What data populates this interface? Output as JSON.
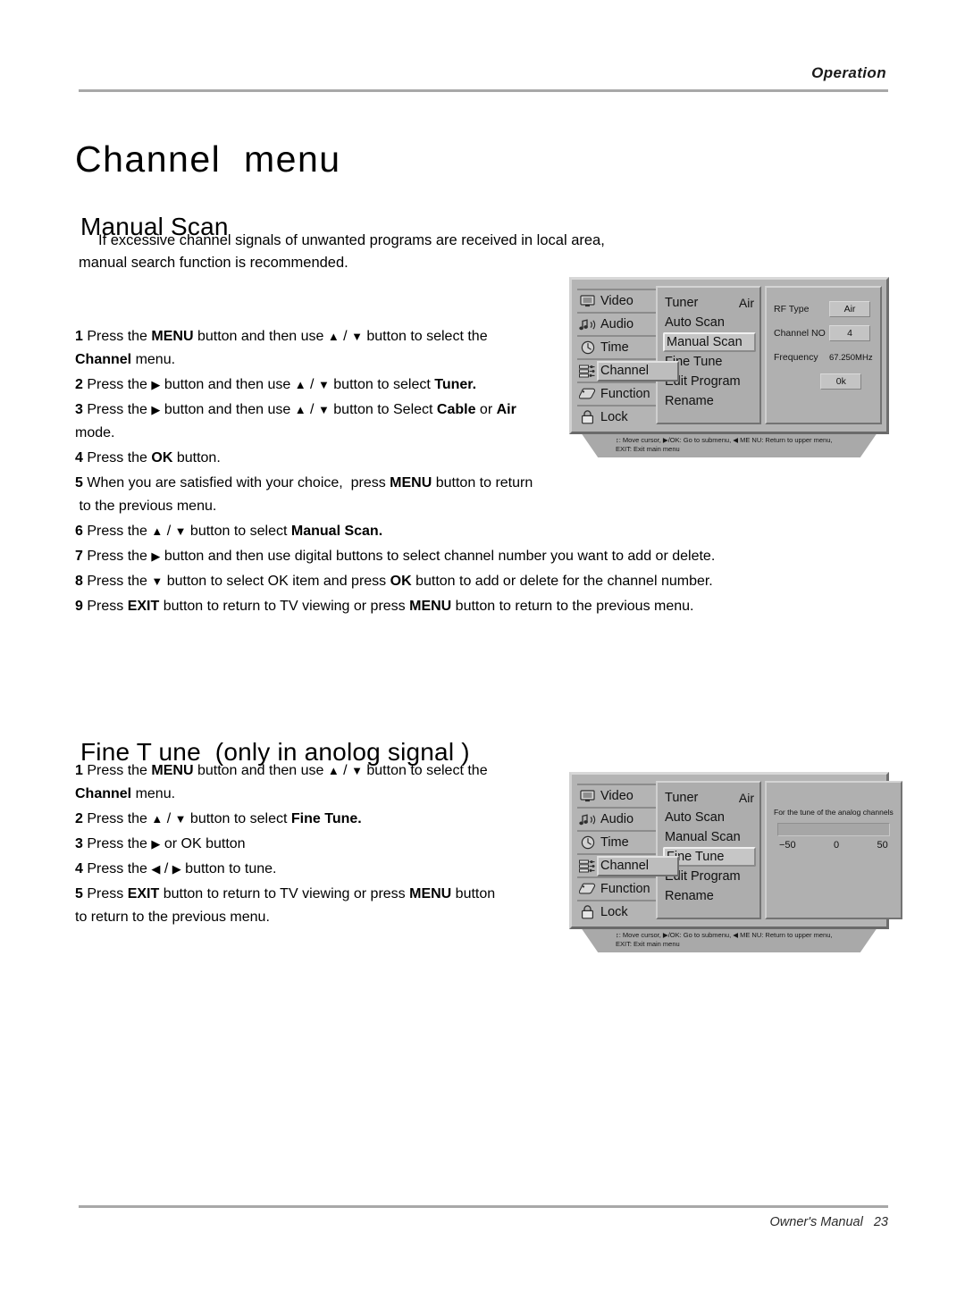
{
  "header": {
    "running_head": "Operation"
  },
  "footer": {
    "manual_label": "Owner's Manual",
    "page_number": "23"
  },
  "doc": {
    "title": "Channel  menu"
  },
  "manual_scan": {
    "section_title": "Manual Scan",
    "intro_line1": "If excessive channel signals of unwanted programs are received in local area,",
    "intro_line2": "manual search function is recommended.",
    "steps": [
      {
        "num": "1",
        "text": "Press the MENU button and then use ▲ / ▼ button to select the\nChannel menu."
      },
      {
        "num": "2",
        "text": "Press the ▶ button and then use ▲ / ▼ button to select Tuner."
      },
      {
        "num": "3",
        "text": "Press the ▶ button and then use ▲ / ▼ button to Select Cable or Air\nmode."
      },
      {
        "num": "4",
        "text": "Press the OK button."
      },
      {
        "num": "5",
        "text": "When you are satisfied with your choice,  press MENU button to return\n to the previous menu."
      },
      {
        "num": "6",
        "text": "Press the ▲ / ▼ button to select Manual Scan."
      },
      {
        "num": "7",
        "text": "Press the ▶ button and then use digital buttons to select channel number you want to add or delete."
      },
      {
        "num": "8",
        "text": "Press the ▼ button to select OK item and press OK button to add or delete for the channel number."
      },
      {
        "num": "9",
        "text": "Press EXIT button to return to TV viewing or press MENU button to return to the previous menu."
      }
    ]
  },
  "fine_tune": {
    "section_title": "Fine T une  (only in anolog signal )",
    "steps": [
      {
        "num": "1",
        "text": "Press the MENU button and then use ▲ / ▼ button to select the\nChannel menu."
      },
      {
        "num": "2",
        "text": "Press the ▲ / ▼ button to select Fine Tune."
      },
      {
        "num": "3",
        "text": "Press the ▶ or OK button"
      },
      {
        "num": "4",
        "text": "Press the ◀ / ▶ button to tune."
      },
      {
        "num": "5",
        "text": "Press EXIT button to return to TV viewing or press MENU button\nto return to the previous menu."
      }
    ]
  },
  "osd": {
    "sidebar": [
      {
        "label": "Video",
        "icon": "monitor-icon",
        "active": false
      },
      {
        "label": "Audio",
        "icon": "music-note-icon",
        "active": false
      },
      {
        "label": "Time",
        "icon": "clock-icon",
        "active": false
      },
      {
        "label": "Channel",
        "icon": "sliders-icon",
        "active": true
      },
      {
        "label": "Function",
        "icon": "tag-icon",
        "active": false
      },
      {
        "label": "Lock",
        "icon": "padlock-icon",
        "active": false
      }
    ],
    "menu_items": [
      {
        "label": "Tuner",
        "value": "Air"
      },
      {
        "label": "Auto Scan",
        "value": ""
      },
      {
        "label": "Manual Scan",
        "value": ""
      },
      {
        "label": "Fine Tune",
        "value": ""
      },
      {
        "label": "Edit Program",
        "value": ""
      },
      {
        "label": "Rename",
        "value": ""
      }
    ],
    "hint_line1": "↕: Move cursor,  ▶/OK: Go to submenu,  ◀ ME NU: Return to upper menu,",
    "hint_line2": "EXIT: Exit main menu",
    "manual_scan_panel": {
      "selected_item": "Manual Scan",
      "rf_type_label": "RF  Type",
      "rf_type_value": "Air",
      "channel_no_label": "Channel NO",
      "channel_no_value": "4",
      "frequency_label": "Frequency",
      "frequency_value": "67.250MHz",
      "ok_label": "0k"
    },
    "fine_tune_panel": {
      "selected_item": "Fine Tune",
      "caption": "For the tune of the analog channels",
      "scale_min": "−50",
      "scale_mid": "0",
      "scale_max": "50"
    }
  },
  "colors": {
    "rule": "#a8a8a8",
    "osd_body": "#b4b4b4",
    "osd_panel": "#adadad",
    "osd_highlight": "#c6c6c6"
  }
}
